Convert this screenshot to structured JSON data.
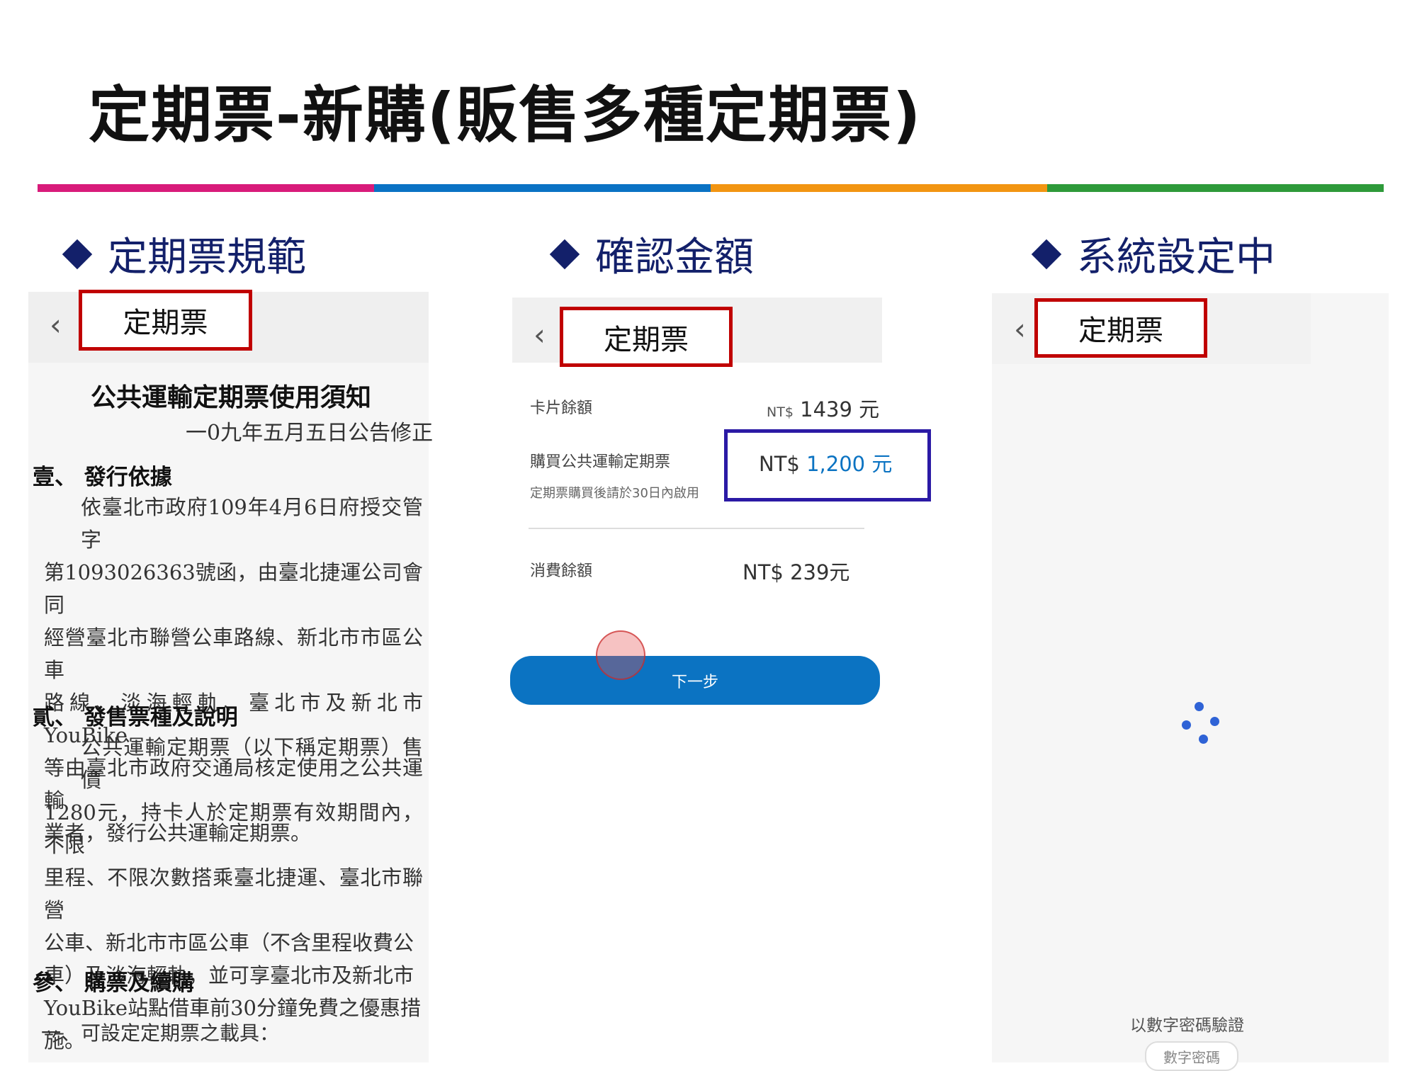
{
  "slide": {
    "title": "定期票-新購(販售多種定期票)",
    "colors": [
      "#d81b7a",
      "#0a72c4",
      "#f29512",
      "#2e9a3a"
    ]
  },
  "sections": [
    {
      "heading": "定期票規範"
    },
    {
      "heading": "確認金額"
    },
    {
      "heading": "系統設定中"
    }
  ],
  "panels": {
    "tab_label": "定期票",
    "back_glyph": "‹",
    "left": {
      "doc_title": "公共運輸定期票使用須知",
      "doc_date": "一0九年五月五日公告修正",
      "sec1": "壹、 發行依據",
      "para1_lines": [
        "依臺北市政府109年4月6日府授交管字",
        "第1093026363號函，由臺北捷運公司會同",
        "經營臺北市聯營公車路線、新北市市區公車",
        "路線、淡海輕軌、臺北市及新北市YouBike",
        "等由臺北市政府交通局核定使用之公共運輸",
        "業者，發行公共運輸定期票。"
      ],
      "sec2": "貳、 發售票種及說明",
      "para2_lines": [
        "公共運輸定期票（以下稱定期票）售價",
        "1280元，持卡人於定期票有效期間內，不限",
        "里程、不限次數搭乘臺北捷運、臺北市聯營",
        "公車、新北市市區公車（不含里程收費公",
        "車）及淡海輕軌，並可享臺北市及新北市",
        "YouBike站點借車前30分鐘免費之優惠措",
        "施。"
      ],
      "sec3": "參、 購票及續購",
      "item1": "一、可設定定期票之載具："
    },
    "middle": {
      "card_balance_label": "卡片餘額",
      "card_balance_currency": "NT$",
      "card_balance_value": "1439 元",
      "purchase_label": "購買公共運輸定期票",
      "purchase_note": "定期票購買後請於30日內啟用",
      "purchase_currency": "NT$",
      "purchase_amount": "1,200",
      "purchase_unit": "元",
      "remaining_label": "消費餘額",
      "remaining_value": "NT$ 239元",
      "next_button": "下一步",
      "accent": "#0b73c2"
    },
    "right": {
      "verify_text": "以數字密碼驗證",
      "pin_chip": "數字密碼"
    }
  }
}
